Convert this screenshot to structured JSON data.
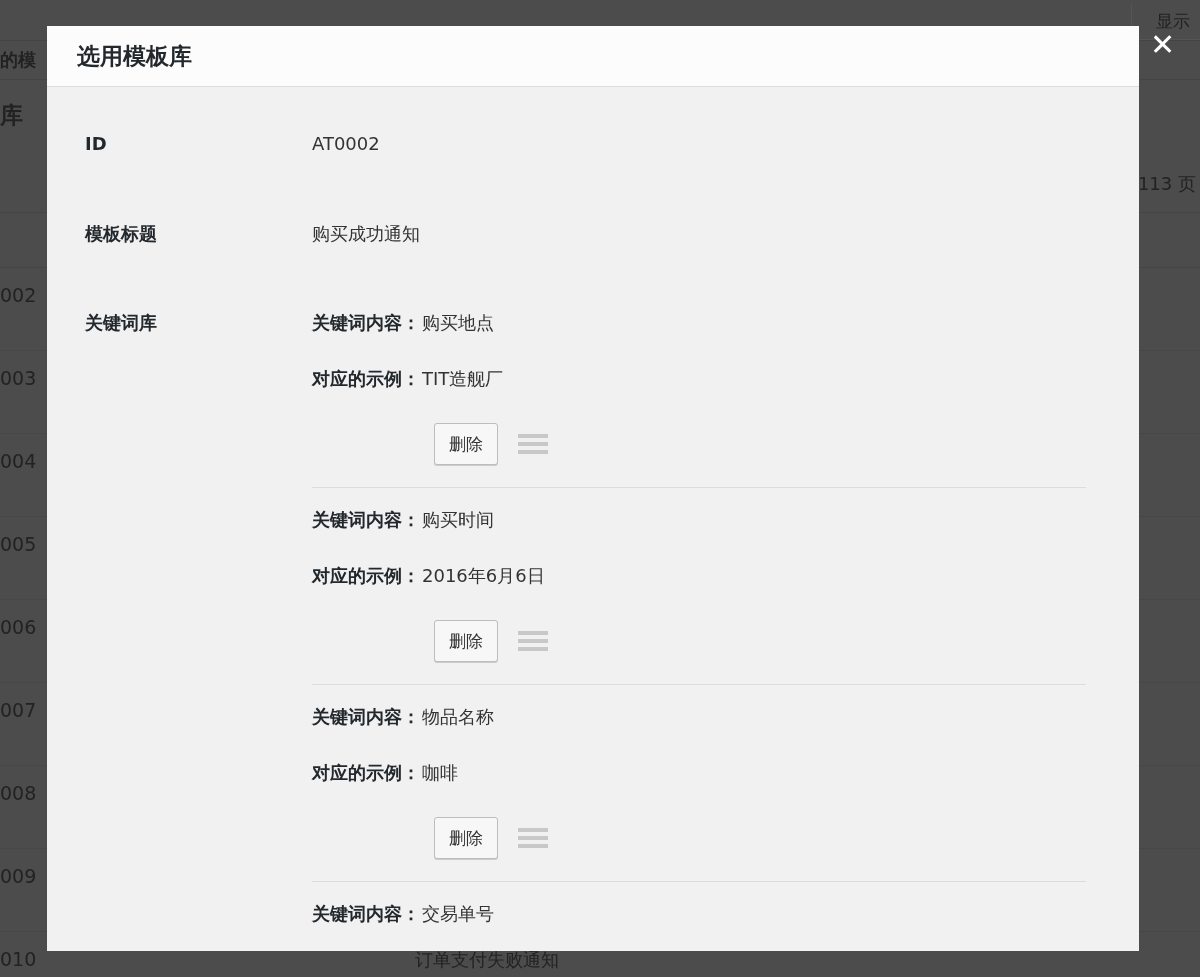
{
  "background_page": {
    "top_button": "显示",
    "section_heading_fragment": "的模",
    "page_title_fragment": "库",
    "pagination": "113 页",
    "rows": [
      {
        "id": "002"
      },
      {
        "id": "003"
      },
      {
        "id": "004"
      },
      {
        "id": "005"
      },
      {
        "id": "006"
      },
      {
        "id": "007"
      },
      {
        "id": "008"
      },
      {
        "id": "009"
      },
      {
        "id": "010",
        "title": "订单支付失败通知"
      }
    ]
  },
  "modal": {
    "title": "选用模板库",
    "close": "✕",
    "fields": [
      {
        "label": "ID",
        "value": "AT0002"
      },
      {
        "label": "模板标题",
        "value": "购买成功通知"
      }
    ],
    "keywords_label": "关键词库",
    "keywords": [
      {
        "keyword_label": "关键词内容：",
        "keyword": "购买地点",
        "example_label": "对应的示例：",
        "example": "TIT造舰厂",
        "delete": "删除"
      },
      {
        "keyword_label": "关键词内容：",
        "keyword": "购买时间",
        "example_label": "对应的示例：",
        "example": "2016年6月6日",
        "delete": "删除"
      },
      {
        "keyword_label": "关键词内容：",
        "keyword": "物品名称",
        "example_label": "对应的示例：",
        "example": "咖啡",
        "delete": "删除"
      },
      {
        "keyword_label": "关键词内容：",
        "keyword": "交易单号"
      }
    ]
  }
}
